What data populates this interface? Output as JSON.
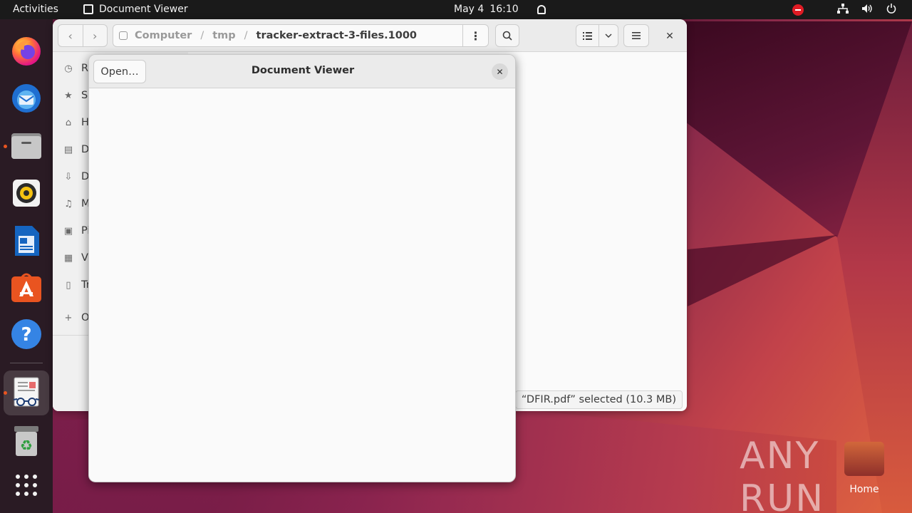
{
  "topbar": {
    "activities": "Activities",
    "app_name": "Document Viewer",
    "date": "May 4",
    "time": "16:10"
  },
  "dock": {
    "items": [
      {
        "name": "firefox"
      },
      {
        "name": "thunderbird"
      },
      {
        "name": "files"
      },
      {
        "name": "rhythmbox"
      },
      {
        "name": "libreoffice-writer"
      },
      {
        "name": "app-center"
      },
      {
        "name": "help"
      },
      {
        "name": "document-viewer"
      },
      {
        "name": "trash"
      },
      {
        "name": "show-apps"
      }
    ]
  },
  "files_window": {
    "path": [
      "Computer",
      "tmp",
      "tracker-extract-3-files.1000"
    ],
    "sidebar": [
      {
        "label": "R",
        "icon": "clock-icon"
      },
      {
        "label": "S",
        "icon": "star-icon"
      },
      {
        "label": "H",
        "icon": "home-icon"
      },
      {
        "label": "D",
        "icon": "document-icon"
      },
      {
        "label": "D",
        "icon": "download-icon"
      },
      {
        "label": "M",
        "icon": "music-icon"
      },
      {
        "label": "Pi",
        "icon": "picture-icon"
      },
      {
        "label": "V",
        "icon": "video-icon"
      },
      {
        "label": "Tr",
        "icon": "trash-icon"
      },
      {
        "label": "O",
        "icon": "plus-icon"
      }
    ],
    "status": "“DFIR.pdf” selected (10.3 MB)"
  },
  "doc_viewer": {
    "open_button": "Open…",
    "title": "Document Viewer"
  },
  "desktop": {
    "watermark": "ANY RUN",
    "home_label": "Home"
  }
}
